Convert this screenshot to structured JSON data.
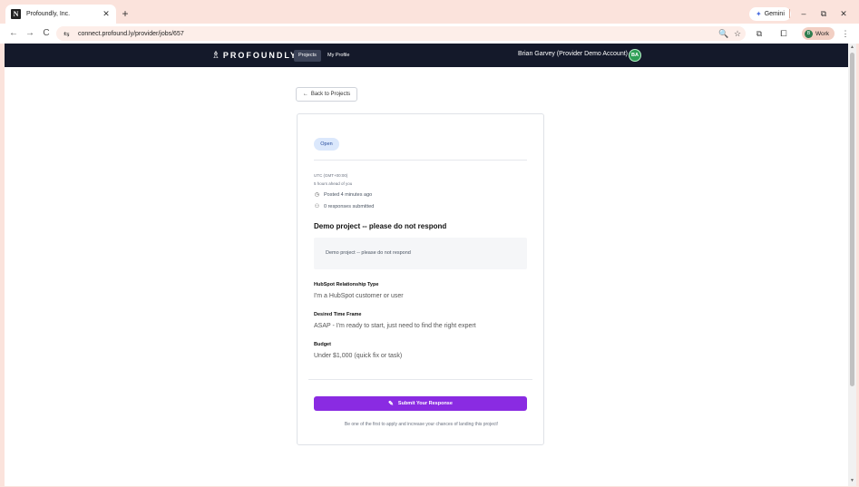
{
  "browser": {
    "tab_title": "Profoundly, Inc.",
    "favicon_letter": "N",
    "tab_close": "✕",
    "new_tab": "+",
    "gemini_label": "Gemini",
    "url": "connect.profound.ly/provider/jobs/657",
    "profile_initial": "B",
    "profile_label": "Work",
    "icons": {
      "back": "←",
      "forward": "→",
      "reload": "C",
      "tune": "⇆",
      "zoom": "🔍",
      "star": "☆",
      "extensions": "⧉",
      "split": "⧠",
      "menu": "⋮",
      "minimize": "–",
      "restore": "⧉",
      "close": "✕"
    }
  },
  "nav": {
    "brand": "PROFOUNDLY",
    "brand_mark": "♗",
    "links": {
      "projects": "Projects",
      "profile": "My Profile"
    },
    "user_name": "Brian Garvey (Provider Demo Account)",
    "user_initials": "BA"
  },
  "page": {
    "back_label": "Back to Projects",
    "back_arrow": "←",
    "status": "Open",
    "timezone": "UTC (GMT+00:00)",
    "time_offset": "5 hours ahead of you",
    "posted": "Posted 4 minutes ago",
    "responses": "0 responses submitted",
    "title": "Demo project -- please do not respond",
    "description": "Demo project -- please do not respond",
    "fields": [
      {
        "label": "HubSpot Relationship Type",
        "value": "I'm a HubSpot customer or user"
      },
      {
        "label": "Desired Time Frame",
        "value": "ASAP - I'm ready to start, just need to find the right expert"
      },
      {
        "label": "Budget",
        "value": "Under $1,000 (quick fix or task)"
      }
    ],
    "submit_label": "Submit Your Response",
    "submit_icon": "✎",
    "footnote": "Be one of the first to apply and increase your chances of landing this project!",
    "icons": {
      "clock": "◷",
      "users": "⚇"
    }
  }
}
